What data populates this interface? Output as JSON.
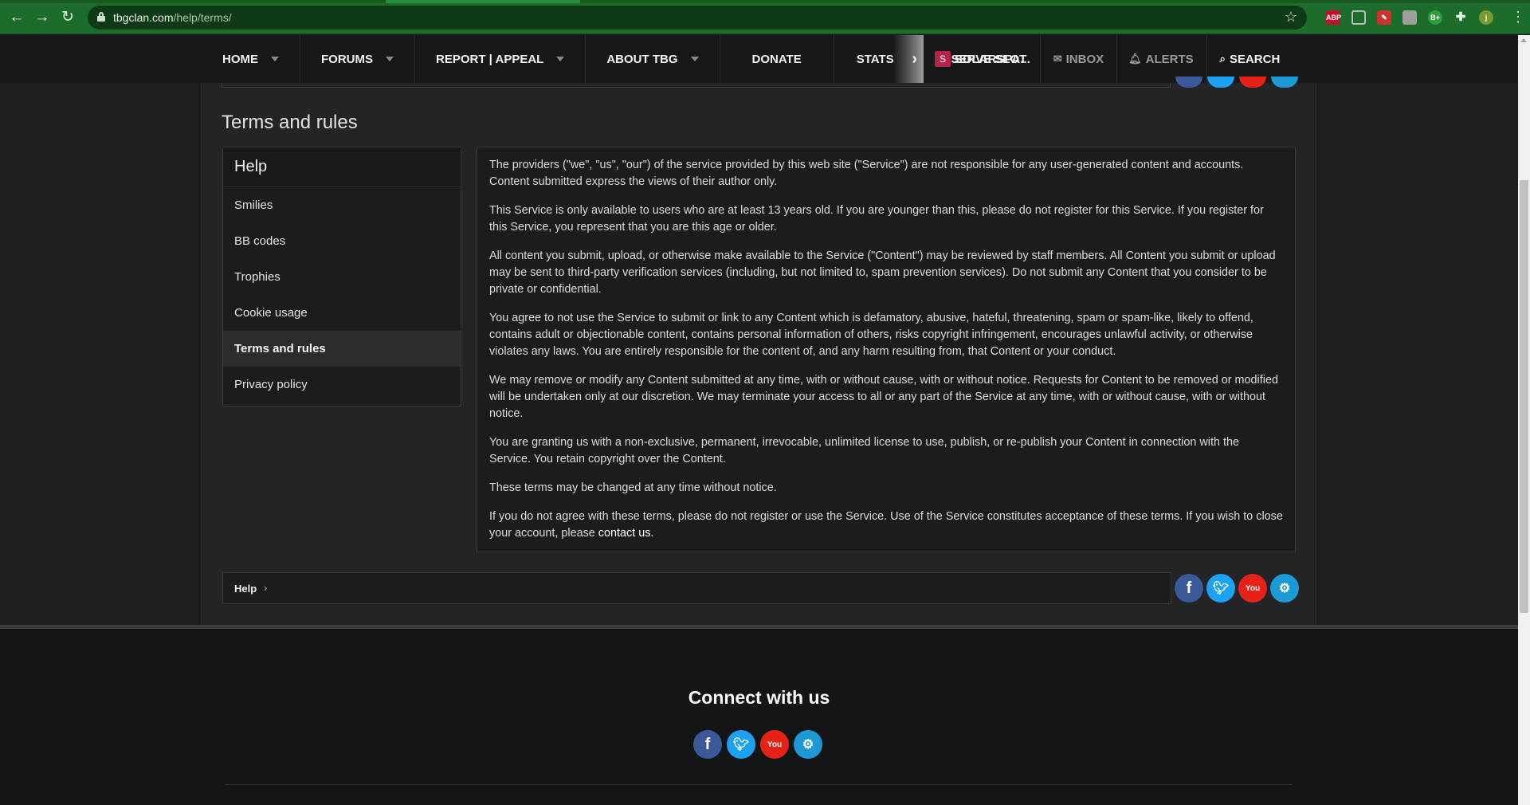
{
  "browser": {
    "url_host": "tbgclan.com",
    "url_path": "/help/terms/",
    "back_icon": "arrow-left",
    "forward_icon": "arrow-right",
    "reload_icon": "reload",
    "bookmark_icon": "star",
    "extensions": [
      {
        "name": "adblock",
        "label": "ABP",
        "color": "#c70d2c"
      },
      {
        "name": "screenshot",
        "label": "",
        "color": "#8a8a8a"
      },
      {
        "name": "pen",
        "label": "",
        "color": "#d0312d"
      },
      {
        "name": "translate",
        "label": "",
        "color": "#9e9e9e"
      },
      {
        "name": "b-plus",
        "label": "B+",
        "color": "#2e9e3e"
      },
      {
        "name": "puzzle",
        "label": "",
        "color": "#e6f0e6"
      },
      {
        "name": "profile",
        "label": "j",
        "color": "#7a9a2f"
      }
    ]
  },
  "nav": {
    "items": [
      {
        "label": "HOME",
        "caret": true
      },
      {
        "label": "FORUMS",
        "caret": true
      },
      {
        "label": "REPORT | APPEAL",
        "caret": true
      },
      {
        "label": "ABOUT TBG",
        "caret": true
      },
      {
        "label": "DONATE",
        "caret": false
      },
      {
        "label": "STATS",
        "caret": false
      },
      {
        "label": "RESERVE SLOT",
        "caret": false
      }
    ],
    "user_avatar_letter": "S",
    "user_name": "SOLARSPA...",
    "inbox_label": "INBOX",
    "alerts_label": "ALERTS",
    "search_label": "SEARCH"
  },
  "page": {
    "title": "Terms and rules"
  },
  "help_menu": {
    "header": "Help",
    "items": [
      "Smilies",
      "BB codes",
      "Trophies",
      "Cookie usage",
      "Terms and rules",
      "Privacy policy"
    ],
    "active_index": 4
  },
  "terms": {
    "p1": "The providers (\"we\", \"us\", \"our\") of the service provided by this web site (\"Service\") are not responsible for any user-generated content and accounts. Content submitted express the views of their author only.",
    "p2": "This Service is only available to users who are at least 13 years old. If you are younger than this, please do not register for this Service. If you register for this Service, you represent that you are this age or older.",
    "p3": "All content you submit, upload, or otherwise make available to the Service (\"Content\") may be reviewed by staff members. All Content you submit or upload may be sent to third-party verification services (including, but not limited to, spam prevention services). Do not submit any Content that you consider to be private or confidential.",
    "p4": "You agree to not use the Service to submit or link to any Content which is defamatory, abusive, hateful, threatening, spam or spam-like, likely to offend, contains adult or objectionable content, contains personal information of others, risks copyright infringement, encourages unlawful activity, or otherwise violates any laws. You are entirely responsible for the content of, and any harm resulting from, that Content or your conduct.",
    "p5": "We may remove or modify any Content submitted at any time, with or without cause, with or without notice. Requests for Content to be removed or modified will be undertaken only at our discretion. We may terminate your access to all or any part of the Service at any time, with or without cause, with or without notice.",
    "p6": "You are granting us with a non-exclusive, permanent, irrevocable, unlimited license to use, publish, or re-publish your Content in connection with the Service. You retain copyright over the Content.",
    "p7": "These terms may be changed at any time without notice.",
    "p8_before": "If you do not agree with these terms, please do not register or use the Service. Use of the Service constitutes acceptance of these terms. If you wish to close your account, please ",
    "p8_link": "contact us",
    "p8_after": "."
  },
  "breadcrumb": {
    "label": "Help",
    "separator": "›"
  },
  "social": {
    "facebook": "f",
    "twitter": "t",
    "youtube": "You",
    "steam": "s"
  },
  "footer": {
    "heading": "Connect with us"
  }
}
